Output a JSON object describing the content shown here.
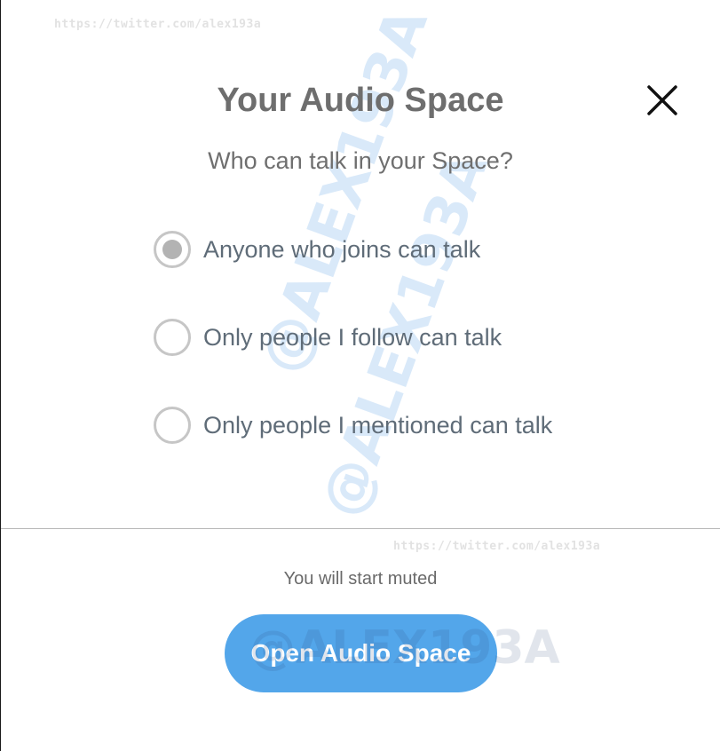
{
  "dialog": {
    "title": "Your Audio Space",
    "close_icon": "close-icon",
    "subtitle": "Who can talk in your Space?",
    "options": [
      {
        "label": "Anyone who joins can talk",
        "selected": true
      },
      {
        "label": "Only people I follow can talk",
        "selected": false
      },
      {
        "label": "Only people I mentioned can talk",
        "selected": false
      }
    ],
    "muted_hint": "You will start muted",
    "primary_button": "Open Audio Space"
  },
  "watermark": {
    "url": "https://twitter.com/alex193a",
    "handle": "@ALEX193A"
  },
  "colors": {
    "accent": "#53a6ea",
    "title": "#6e6e6e",
    "option_text": "#5f6c78"
  }
}
